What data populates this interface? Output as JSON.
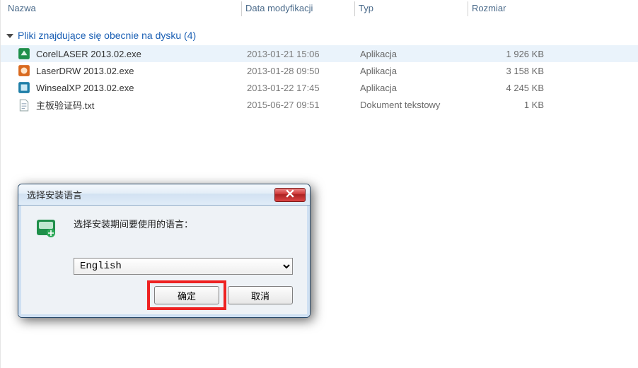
{
  "columns": {
    "name": "Nazwa",
    "date": "Data modyfikacji",
    "type": "Typ",
    "size": "Rozmiar"
  },
  "group": {
    "label": "Pliki znajdujące się obecnie na dysku (4)"
  },
  "files": [
    {
      "icon": "app-green",
      "name": "CorelLASER 2013.02.exe",
      "date": "2013-01-21 15:06",
      "type": "Aplikacja",
      "size": "1 926 KB",
      "selected": true
    },
    {
      "icon": "app-orange",
      "name": "LaserDRW 2013.02.exe",
      "date": "2013-01-28 09:50",
      "type": "Aplikacja",
      "size": "3 158 KB",
      "selected": false
    },
    {
      "icon": "app-teal",
      "name": "WinsealXP 2013.02.exe",
      "date": "2013-01-22 17:45",
      "type": "Aplikacja",
      "size": "4 245 KB",
      "selected": false
    },
    {
      "icon": "txt",
      "name": "主板验证码.txt",
      "date": "2015-06-27 09:51",
      "type": "Dokument tekstowy",
      "size": "1 KB",
      "selected": false
    }
  ],
  "dialog": {
    "title": "选择安装语言",
    "message": "选择安装期间要使用的语言：",
    "selected_language": "English",
    "ok_label": "确定",
    "cancel_label": "取消"
  }
}
